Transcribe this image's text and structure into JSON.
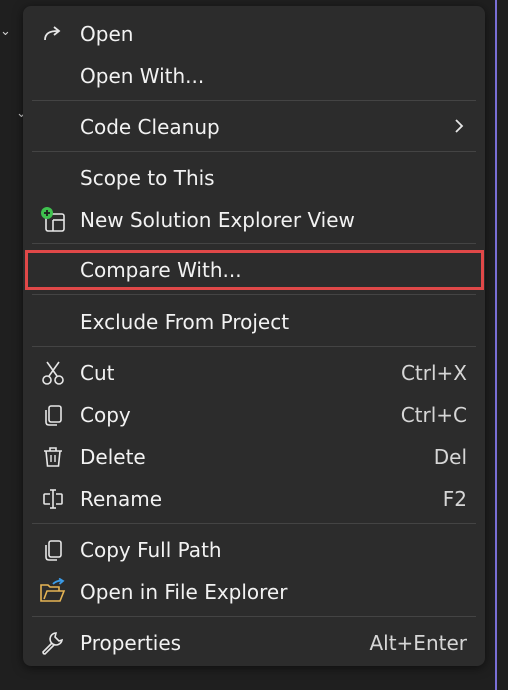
{
  "menu": {
    "items": [
      {
        "label": "Open",
        "shortcut": "",
        "icon": "redirect-arrow-icon"
      },
      {
        "label": "Open With...",
        "shortcut": "",
        "icon": ""
      },
      {
        "label": "Code Cleanup",
        "shortcut": "",
        "icon": "",
        "submenu": true
      },
      {
        "label": "Scope to This",
        "shortcut": "",
        "icon": ""
      },
      {
        "label": "New Solution Explorer View",
        "shortcut": "",
        "icon": "new-solution-explorer-view-icon"
      },
      {
        "label": "Compare With...",
        "shortcut": "",
        "icon": "",
        "highlighted": true
      },
      {
        "label": "Exclude From Project",
        "shortcut": "",
        "icon": ""
      },
      {
        "label": "Cut",
        "shortcut": "Ctrl+X",
        "icon": "scissors-icon"
      },
      {
        "label": "Copy",
        "shortcut": "Ctrl+C",
        "icon": "copy-icon"
      },
      {
        "label": "Delete",
        "shortcut": "Del",
        "icon": "trash-icon"
      },
      {
        "label": "Rename",
        "shortcut": "F2",
        "icon": "rename-icon"
      },
      {
        "label": "Copy Full Path",
        "shortcut": "",
        "icon": "copy-icon"
      },
      {
        "label": "Open in File Explorer",
        "shortcut": "",
        "icon": "folder-open-icon"
      },
      {
        "label": "Properties",
        "shortcut": "Alt+Enter",
        "icon": "wrench-icon"
      }
    ]
  },
  "colors": {
    "menu_bg": "#2c2c2c",
    "text": "#f2f2f2",
    "highlight_border": "#e04848",
    "accent_green": "#3fc24f",
    "folder_yellow": "#e5b454",
    "folder_blue": "#3a9be8"
  }
}
